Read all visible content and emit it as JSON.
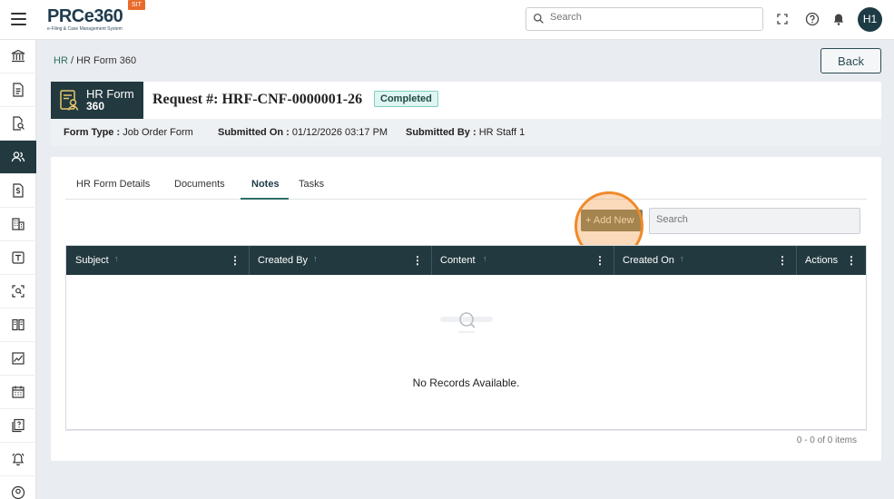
{
  "header": {
    "logo_text": "PRCe360",
    "logo_subtitle": "e-Filing & Case Management System",
    "env_badge": "SIT",
    "search_placeholder": "Search",
    "avatar_initials": "H1"
  },
  "sidebar": {
    "items": [
      {
        "icon": "bank-icon"
      },
      {
        "icon": "document-icon"
      },
      {
        "icon": "document-search-icon"
      },
      {
        "icon": "users-icon",
        "active": true
      },
      {
        "icon": "dollar-document-icon"
      },
      {
        "icon": "building-icon"
      },
      {
        "icon": "text-box-icon"
      },
      {
        "icon": "scan-icon"
      },
      {
        "icon": "book-icon"
      },
      {
        "icon": "chart-icon"
      },
      {
        "icon": "calendar-icon"
      },
      {
        "icon": "help-document-icon"
      },
      {
        "icon": "bell-icon"
      },
      {
        "icon": "user-circle-icon"
      }
    ]
  },
  "breadcrumb": {
    "root": "HR",
    "separator": " / ",
    "current": "HR Form 360"
  },
  "back_button": "Back",
  "request": {
    "badge_line1": "HR Form",
    "badge_line2": "360",
    "title": "Request #: HRF-CNF-0000001-26",
    "status": "Completed"
  },
  "meta": {
    "form_type_label": "Form Type :",
    "form_type_value": "Job Order Form",
    "submitted_on_label": "Submitted On :",
    "submitted_on_value": "01/12/2026 03:17 PM",
    "submitted_by_label": "Submitted By :",
    "submitted_by_value": "HR Staff 1"
  },
  "tabs": [
    {
      "label": "HR Form Details"
    },
    {
      "label": "Documents"
    },
    {
      "label": "Notes",
      "active": true
    },
    {
      "label": "Tasks"
    }
  ],
  "toolbar": {
    "add_label": "+ Add New",
    "search_placeholder": "Search"
  },
  "grid": {
    "columns": [
      {
        "label": "Subject"
      },
      {
        "label": "Created By"
      },
      {
        "label": "Content"
      },
      {
        "label": "Created On"
      },
      {
        "label": "Actions"
      }
    ],
    "empty_text": "No Records Available.",
    "pager_text": "0 - 0 of 0 items"
  },
  "colors": {
    "primary_dark": "#22393f",
    "accent": "#2f6f66",
    "highlight": "#f08a2b",
    "status_bg": "#dff5f1"
  }
}
